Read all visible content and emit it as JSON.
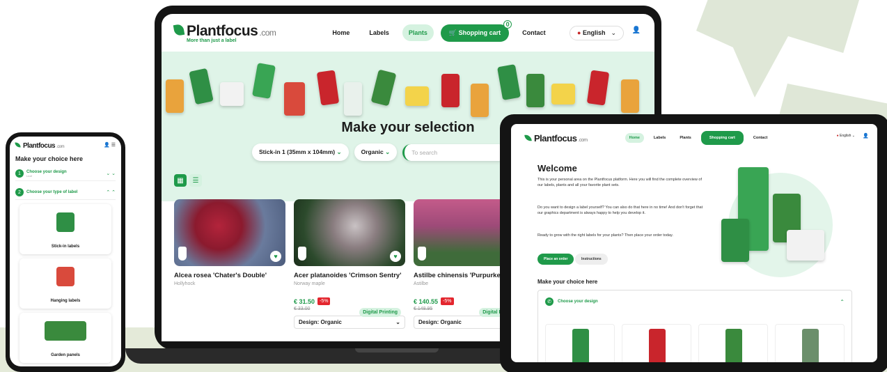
{
  "brand": {
    "name": "Plantfocus",
    "domain": ".com",
    "tagline": "More than just a label"
  },
  "colors": {
    "accent": "#1f9a4a",
    "accent_light": "#d5f2e0",
    "discount": "#e3262e"
  },
  "laptop": {
    "nav": {
      "home": "Home",
      "labels": "Labels",
      "plants": "Plants",
      "cart": "Shopping cart",
      "cart_count": "0",
      "contact": "Contact",
      "language": "English"
    },
    "hero_title": "Make your selection",
    "filters": {
      "size": "Stick-in 1 (35mm x 104mm)",
      "design": "Organic",
      "search_placeholder": "To search"
    },
    "products": [
      {
        "name": "Alcea rosea 'Chater's Double'",
        "common": "Hollyhock"
      },
      {
        "name": "Acer platanoides 'Crimson Sentry'",
        "common": "Norway maple",
        "price": "€ 31.50",
        "discount": "-5%",
        "old_price": "€ 33.00",
        "badge": "Digital Printing",
        "design": "Design: Organic"
      },
      {
        "name": "Astilbe chinensis 'Purpurkerze'",
        "common": "Astilbe",
        "price": "€ 140.55",
        "discount": "-5%",
        "old_price": "€ 148.95",
        "badge": "Digital Printing",
        "design": "Design: Organic"
      }
    ]
  },
  "phone": {
    "title": "Make your choice here",
    "steps": [
      {
        "num": "1",
        "label": "Choose your design",
        "sub": "Leaf"
      },
      {
        "num": "2",
        "label": "Choose your type of label"
      }
    ],
    "options": [
      "Stick-in labels",
      "Hanging labels",
      "Garden panels"
    ]
  },
  "tablet": {
    "nav": {
      "home": "Home",
      "labels": "Labels",
      "plants": "Plants",
      "cart": "Shopping cart",
      "contact": "Contact",
      "language": "English"
    },
    "welcome": "Welcome",
    "p1": "This is your personal area on the Plantfocus platform. Here you will find the complete overview of our labels, plants and all your favorite plant sets.",
    "p2": "Do you want to design a label yourself? You can also do that here in no time! And don't forget that our graphics department is always happy to help you develop it.",
    "p3": "Ready to grow with the right labels for your plants? Then place your order today.",
    "btn_order": "Place an order",
    "btn_inst": "Instructions",
    "choice_title": "Make your choice here",
    "step1": "Choose your design"
  }
}
